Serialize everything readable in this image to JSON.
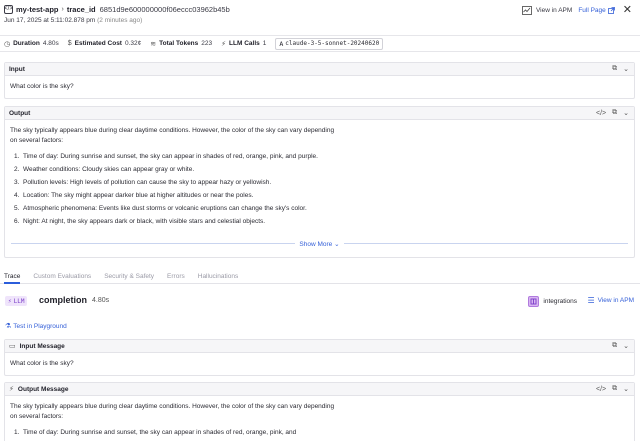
{
  "header": {
    "app_name": "my-test-app",
    "breadcrumb_key": "trace_id",
    "trace_id": "6851d9e600000000f06eccc03962b45b",
    "timestamp": "Jun 17, 2025 at 5:11:02.878 pm",
    "relative_time": "(2 minutes ago)",
    "view_in_apm": "View in APM",
    "full_page": "Full Page"
  },
  "metrics": {
    "duration_label": "Duration",
    "duration_value": "4.80s",
    "cost_label": "Estimated Cost",
    "cost_value": "0.32¢",
    "tokens_label": "Total Tokens",
    "tokens_value": "223",
    "calls_label": "LLM Calls",
    "calls_value": "1",
    "model": "claude-3-5-sonnet-20240620"
  },
  "input_panel": {
    "title": "Input",
    "text": "What color is the sky?"
  },
  "output_panel": {
    "title": "Output",
    "intro": "The sky typically appears blue during clear daytime conditions. However, the color of the sky can vary depending on several factors:",
    "items": [
      {
        "num": "1.",
        "text": "Time of day: During sunrise and sunset, the sky can appear in shades of red, orange, pink, and purple."
      },
      {
        "num": "2.",
        "text": "Weather conditions: Cloudy skies can appear gray or white."
      },
      {
        "num": "3.",
        "text": "Pollution levels: High levels of pollution can cause the sky to appear hazy or yellowish."
      },
      {
        "num": "4.",
        "text": "Location: The sky might appear darker blue at higher altitudes or near the poles."
      },
      {
        "num": "5.",
        "text": "Atmospheric phenomena: Events like dust storms or volcanic eruptions can change the sky's color."
      },
      {
        "num": "6.",
        "text": "Night: At night, the sky appears dark or black, with visible stars and celestial objects."
      }
    ],
    "show_more": "Show More"
  },
  "tabs": [
    "Trace",
    "Custom Evaluations",
    "Security & Safety",
    "Errors",
    "Hallucinations"
  ],
  "span": {
    "badge": "LLM",
    "name": "completion",
    "duration": "4.80s",
    "integrations": "integrations",
    "view_in_apm": "View in APM",
    "playground": "Test in Playground"
  },
  "input_message": {
    "title": "Input Message",
    "text": "What color is the sky?"
  },
  "output_message": {
    "title": "Output Message",
    "intro": "The sky typically appears blue during clear daytime conditions. However, the color of the sky can vary depending on several factors:",
    "item1_num": "1.",
    "item1_text": "Time of day: During sunrise and sunset, the sky can appear in shades of red, orange, pink, and"
  },
  "colors": {
    "accent": "#3560d8",
    "llm_badge": "#7a3cc8"
  }
}
